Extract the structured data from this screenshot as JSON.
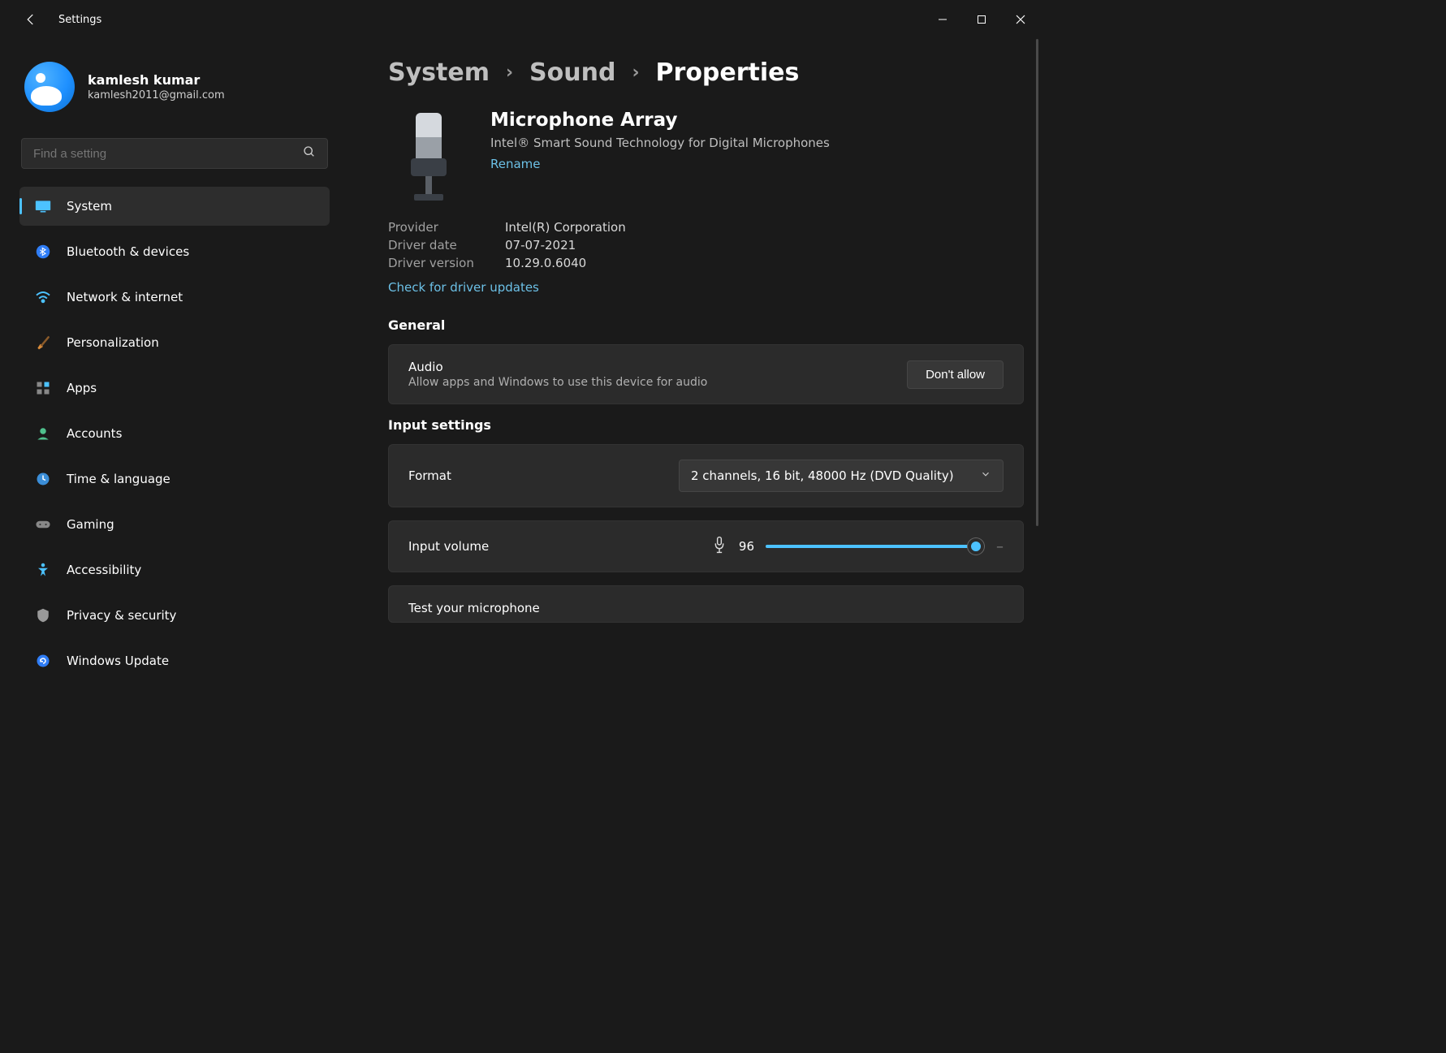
{
  "window": {
    "title": "Settings"
  },
  "profile": {
    "name": "kamlesh kumar",
    "email": "kamlesh2011@gmail.com"
  },
  "search": {
    "placeholder": "Find a setting"
  },
  "sidebar": {
    "items": [
      {
        "label": "System"
      },
      {
        "label": "Bluetooth & devices"
      },
      {
        "label": "Network & internet"
      },
      {
        "label": "Personalization"
      },
      {
        "label": "Apps"
      },
      {
        "label": "Accounts"
      },
      {
        "label": "Time & language"
      },
      {
        "label": "Gaming"
      },
      {
        "label": "Accessibility"
      },
      {
        "label": "Privacy & security"
      },
      {
        "label": "Windows Update"
      }
    ]
  },
  "breadcrumb": {
    "a": "System",
    "b": "Sound",
    "c": "Properties"
  },
  "device": {
    "title": "Microphone Array",
    "sub": "Intel® Smart Sound Technology for Digital Microphones",
    "rename": "Rename",
    "meta": {
      "provider_label": "Provider",
      "provider_value": "Intel(R) Corporation",
      "date_label": "Driver date",
      "date_value": "07-07-2021",
      "version_label": "Driver version",
      "version_value": "10.29.0.6040"
    },
    "check_updates": "Check for driver updates"
  },
  "general": {
    "title": "General",
    "audio": {
      "label": "Audio",
      "desc": "Allow apps and Windows to use this device for audio",
      "button": "Don't allow"
    }
  },
  "input": {
    "title": "Input settings",
    "format": {
      "label": "Format",
      "value": "2 channels, 16 bit, 48000 Hz (DVD Quality)"
    },
    "volume": {
      "label": "Input volume",
      "value": "96",
      "percent": 96
    },
    "test": {
      "label": "Test your microphone"
    }
  }
}
